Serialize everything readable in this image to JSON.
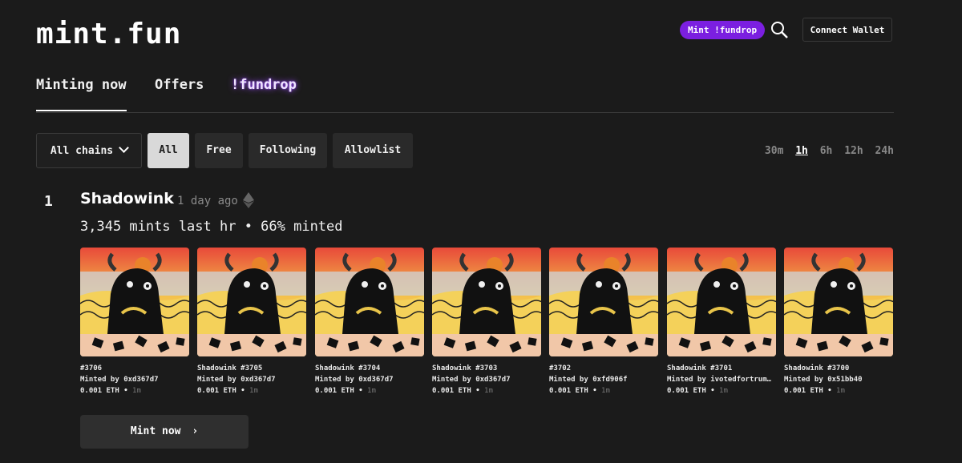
{
  "header": {
    "logo": "mint.fun",
    "fundrop_button": "Mint !fundrop",
    "connect_wallet": "Connect Wallet"
  },
  "tabs": [
    {
      "label": "Minting now",
      "active": true
    },
    {
      "label": "Offers",
      "active": false
    },
    {
      "label": "!fundrop",
      "active": false
    }
  ],
  "filters": {
    "chains_label": "All chains",
    "chips": [
      {
        "label": "All",
        "selected": true
      },
      {
        "label": "Free",
        "selected": false
      },
      {
        "label": "Following",
        "selected": false
      },
      {
        "label": "Allowlist",
        "selected": false
      }
    ],
    "time_ranges": [
      {
        "label": "30m",
        "active": false
      },
      {
        "label": "1h",
        "active": true
      },
      {
        "label": "6h",
        "active": false
      },
      {
        "label": "12h",
        "active": false
      },
      {
        "label": "24h",
        "active": false
      }
    ]
  },
  "collection": {
    "rank": "1",
    "name": "Shadowink",
    "age": "1 day ago",
    "chain_icon": "ethereum-icon",
    "stats": "3,345 mints last hr • 66% minted",
    "mint_button": "Mint now"
  },
  "mints": [
    {
      "title": "#3706",
      "minted_by_prefix": "Minted by ",
      "minter": "0xd367d7",
      "price": "0.001 ETH",
      "age": "1m"
    },
    {
      "title": "Shadowink #3705",
      "minted_by_prefix": "Minted by ",
      "minter": "0xd367d7",
      "price": "0.001 ETH",
      "age": "1m"
    },
    {
      "title": "Shadowink #3704",
      "minted_by_prefix": "Minted by ",
      "minter": "0xd367d7",
      "price": "0.001 ETH",
      "age": "1m"
    },
    {
      "title": "Shadowink #3703",
      "minted_by_prefix": "Minted by ",
      "minter": "0xd367d7",
      "price": "0.001 ETH",
      "age": "1m"
    },
    {
      "title": "#3702",
      "minted_by_prefix": "Minted by ",
      "minter": "0xfd906f",
      "price": "0.001 ETH",
      "age": "1m"
    },
    {
      "title": "Shadowink #3701",
      "minted_by_prefix": "Minted by ",
      "minter": "ivotedfortrum…",
      "price": "0.001 ETH",
      "age": "1m"
    },
    {
      "title": "Shadowink #3700",
      "minted_by_prefix": "Minted by ",
      "minter": "0x51bb40",
      "price": "0.001 ETH",
      "age": "1m"
    }
  ],
  "colors": {
    "background": "#1b1b1b",
    "fundrop_purple": "#7b1fe0",
    "selected_chip": "#d9d9d9"
  }
}
